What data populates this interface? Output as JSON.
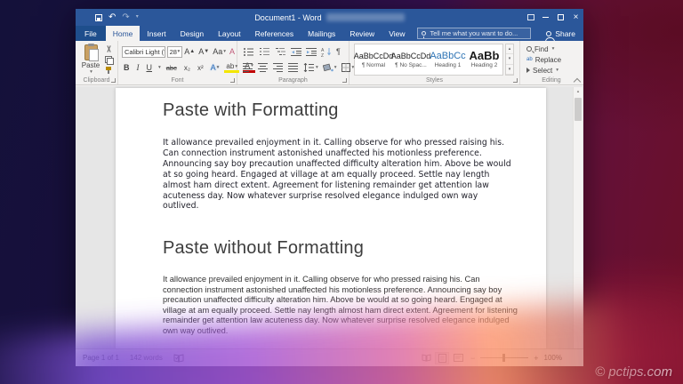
{
  "titlebar": {
    "title": "Document1 - Word"
  },
  "tabs": [
    "File",
    "Home",
    "Insert",
    "Design",
    "Layout",
    "References",
    "Mailings",
    "Review",
    "View"
  ],
  "tellme": "Tell me what you want to do...",
  "share_label": "Share",
  "icons": {
    "undo": "↶",
    "redo": "↷",
    "close": "×",
    "dropdown": "▾",
    "scroll_up": "▴",
    "scroll_down": "▾",
    "gallery_more": "▾",
    "pilcrow": "¶",
    "zoom_minus": "−",
    "zoom_plus": "+"
  },
  "ribbon": {
    "clipboard": {
      "label": "Clipboard",
      "paste": "Paste"
    },
    "font": {
      "label": "Font",
      "name": "Calibri Light (",
      "size": "28",
      "grow": "A",
      "shrink": "A",
      "change_case": "Aa",
      "clear": "A",
      "bold": "B",
      "italic": "I",
      "underline": "U",
      "strike": "abc",
      "subscript": "x₂",
      "superscript": "x²",
      "effects": "A",
      "highlight": "ab",
      "color": "A"
    },
    "paragraph": {
      "label": "Paragraph"
    },
    "styles": {
      "label": "Styles",
      "items": [
        {
          "preview": "AaBbCcDd",
          "name": "¶ Normal"
        },
        {
          "preview": "AaBbCcDd",
          "name": "¶ No Spac..."
        },
        {
          "preview": "AaBbCc",
          "name": "Heading 1"
        },
        {
          "preview": "AaBb",
          "name": "Heading 2"
        }
      ]
    },
    "editing": {
      "label": "Editing",
      "find": "Find",
      "replace": "Replace",
      "select": "Select"
    }
  },
  "document": {
    "heading1": "Paste with Formatting",
    "paragraph1": "It allowance prevailed enjoyment in it. Calling observe for who pressed raising his. Can connection instrument astonished unaffected his motionless preference. Announcing say boy precaution unaffected difficulty alteration him. Above be would at so going heard. Engaged at village at am equally proceed. Settle nay length almost ham direct extent. Agreement for listening remainder get attention law acuteness day. Now whatever surprise resolved elegance indulged own way outlived.",
    "heading2": "Paste without Formatting",
    "paragraph2": "It allowance prevailed enjoyment in it. Calling observe for who pressed raising his. Can connection instrument astonished unaffected his motionless preference. Announcing say boy precaution unaffected difficulty alteration him. Above be would at so going heard. Engaged at village at am equally proceed. Settle nay length almost ham direct extent. Agreement for listening remainder get attention law acuteness day. Now whatever surprise resolved elegance indulged own way outlived."
  },
  "statusbar": {
    "page": "Page 1 of 1",
    "words": "142 words",
    "zoom_level": "100%"
  },
  "watermark": "© pctips.com",
  "colors": {
    "accent": "#2b579a",
    "heading1_style": "#2e74b5",
    "background_red": "#6b0f26",
    "background_navy": "#14113a"
  }
}
